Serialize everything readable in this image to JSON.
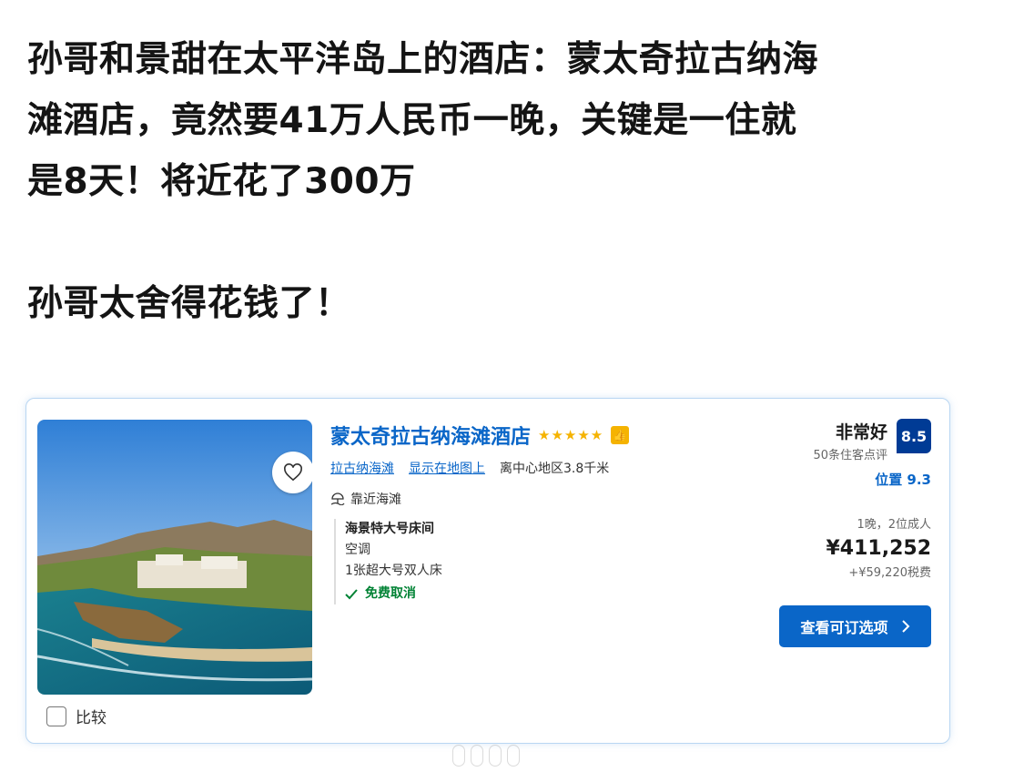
{
  "post": {
    "lines": [
      "孙哥和景甜在太平洋岛上的酒店：蒙太奇拉古纳海",
      "滩酒店，竟然要41万人民币一晚，关键是一住就",
      "是8天！将近花了300万",
      "孙哥太舍得花钱了！"
    ]
  },
  "card": {
    "hotel_name": "蒙太奇拉古纳海滩酒店",
    "stars": "★★★★★",
    "star_count": 5,
    "thumb_badge": "👍",
    "link_area": "拉古纳海滩",
    "link_map": "显示在地图上",
    "distance": "离中心地区3.8千米",
    "beach_label": "靠近海滩",
    "room": {
      "title": "海景特大号床间",
      "feature1": "空调",
      "bed": "1张超大号双人床",
      "cancel": "免费取消"
    },
    "rating": {
      "label": "非常好",
      "reviews": "50条住客点评",
      "score": "8.5",
      "location": "位置 9.3"
    },
    "stay": "1晚，2位成人",
    "price": "¥411,252",
    "tax": "+¥59,220税费",
    "cta_label": "查看可订选项",
    "compare_label": "比较",
    "accent_color": "#0a66c8",
    "score_color": "#003b95",
    "icons": [
      "heart-icon",
      "beach-icon",
      "check-icon",
      "chevron-right-icon",
      "thumbs-up-icon"
    ]
  }
}
